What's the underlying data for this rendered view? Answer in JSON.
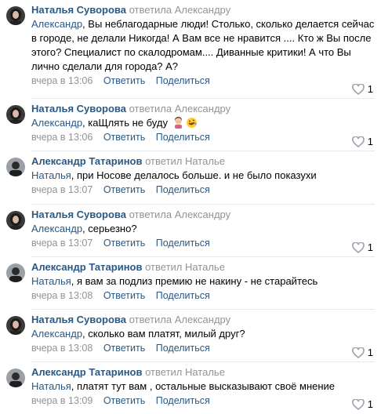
{
  "comments": [
    {
      "author": "Наталья Суворова",
      "reply": "ответила Александру",
      "addressee": "Александр",
      "text": ", Вы неблагодарные люди! Столько, сколько делается сейчас в городе, не делали Никогда! А Вам все не нравится .... Кто ж Вы после этого? Специалист по скалодромам.... Диванные критики! А что Вы лично сделали для города? А?",
      "time": "вчера в 13:06",
      "answer": "Ответить",
      "share": "Поделиться",
      "likes": "1",
      "avatar": "woman"
    },
    {
      "author": "Наталья Суворова",
      "reply": "ответила Александру",
      "addressee": "Александр",
      "text": ", каЩлять не буду",
      "time": "вчера в 13:06",
      "answer": "Ответить",
      "share": "Поделиться",
      "likes": "1",
      "avatar": "woman",
      "emojis": [
        "woman-facepalming-emoji",
        "rolling-laughing-emoji"
      ]
    },
    {
      "author": "Александр Татаринов",
      "reply": "ответил Наталье",
      "addressee": "Наталья",
      "text": ", при Носове делалось больше. и не было показухи",
      "time": "вчера в 13:07",
      "answer": "Ответить",
      "share": "Поделиться",
      "likes": "",
      "avatar": "man"
    },
    {
      "author": "Наталья Суворова",
      "reply": "ответила Александру",
      "addressee": "Александр",
      "text": ", серьезно?",
      "time": "вчера в 13:07",
      "answer": "Ответить",
      "share": "Поделиться",
      "likes": "1",
      "avatar": "woman"
    },
    {
      "author": "Александр Татаринов",
      "reply": "ответил Наталье",
      "addressee": "Наталья",
      "text": ", я вам за подлиз премию не накину - не старайтесь",
      "time": "вчера в 13:08",
      "answer": "Ответить",
      "share": "Поделиться",
      "likes": "",
      "avatar": "man"
    },
    {
      "author": "Наталья Суворова",
      "reply": "ответила Александру",
      "addressee": "Александр",
      "text": ", сколько вам платят, милый друг?",
      "time": "вчера в 13:08",
      "answer": "Ответить",
      "share": "Поделиться",
      "likes": "1",
      "avatar": "woman"
    },
    {
      "author": "Александр Татаринов",
      "reply": "ответил Наталье",
      "addressee": "Наталья",
      "text": ", платят тут вам , остальные высказывают своё мнение",
      "time": "вчера в 13:09",
      "answer": "Ответить",
      "share": "Поделиться",
      "likes": "1",
      "avatar": "man"
    }
  ],
  "colors": {
    "link": "#2a5885",
    "muted": "#939393",
    "separator": "#e7e8ec"
  }
}
